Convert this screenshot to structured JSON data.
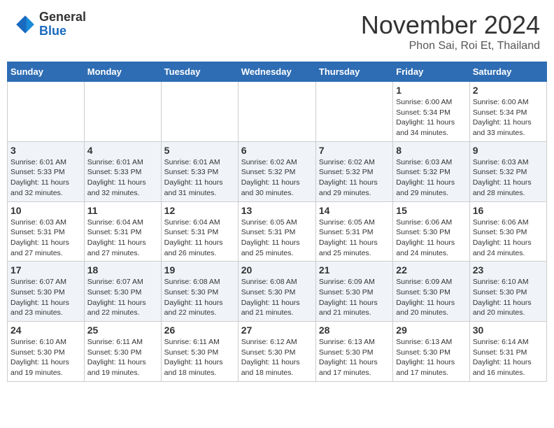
{
  "header": {
    "logo_general": "General",
    "logo_blue": "Blue",
    "month_title": "November 2024",
    "location": "Phon Sai, Roi Et, Thailand"
  },
  "calendar": {
    "days_of_week": [
      "Sunday",
      "Monday",
      "Tuesday",
      "Wednesday",
      "Thursday",
      "Friday",
      "Saturday"
    ],
    "weeks": [
      [
        {
          "day": "",
          "info": ""
        },
        {
          "day": "",
          "info": ""
        },
        {
          "day": "",
          "info": ""
        },
        {
          "day": "",
          "info": ""
        },
        {
          "day": "",
          "info": ""
        },
        {
          "day": "1",
          "info": "Sunrise: 6:00 AM\nSunset: 5:34 PM\nDaylight: 11 hours and 34 minutes."
        },
        {
          "day": "2",
          "info": "Sunrise: 6:00 AM\nSunset: 5:34 PM\nDaylight: 11 hours and 33 minutes."
        }
      ],
      [
        {
          "day": "3",
          "info": "Sunrise: 6:01 AM\nSunset: 5:33 PM\nDaylight: 11 hours and 32 minutes."
        },
        {
          "day": "4",
          "info": "Sunrise: 6:01 AM\nSunset: 5:33 PM\nDaylight: 11 hours and 32 minutes."
        },
        {
          "day": "5",
          "info": "Sunrise: 6:01 AM\nSunset: 5:33 PM\nDaylight: 11 hours and 31 minutes."
        },
        {
          "day": "6",
          "info": "Sunrise: 6:02 AM\nSunset: 5:32 PM\nDaylight: 11 hours and 30 minutes."
        },
        {
          "day": "7",
          "info": "Sunrise: 6:02 AM\nSunset: 5:32 PM\nDaylight: 11 hours and 29 minutes."
        },
        {
          "day": "8",
          "info": "Sunrise: 6:03 AM\nSunset: 5:32 PM\nDaylight: 11 hours and 29 minutes."
        },
        {
          "day": "9",
          "info": "Sunrise: 6:03 AM\nSunset: 5:32 PM\nDaylight: 11 hours and 28 minutes."
        }
      ],
      [
        {
          "day": "10",
          "info": "Sunrise: 6:03 AM\nSunset: 5:31 PM\nDaylight: 11 hours and 27 minutes."
        },
        {
          "day": "11",
          "info": "Sunrise: 6:04 AM\nSunset: 5:31 PM\nDaylight: 11 hours and 27 minutes."
        },
        {
          "day": "12",
          "info": "Sunrise: 6:04 AM\nSunset: 5:31 PM\nDaylight: 11 hours and 26 minutes."
        },
        {
          "day": "13",
          "info": "Sunrise: 6:05 AM\nSunset: 5:31 PM\nDaylight: 11 hours and 25 minutes."
        },
        {
          "day": "14",
          "info": "Sunrise: 6:05 AM\nSunset: 5:31 PM\nDaylight: 11 hours and 25 minutes."
        },
        {
          "day": "15",
          "info": "Sunrise: 6:06 AM\nSunset: 5:30 PM\nDaylight: 11 hours and 24 minutes."
        },
        {
          "day": "16",
          "info": "Sunrise: 6:06 AM\nSunset: 5:30 PM\nDaylight: 11 hours and 24 minutes."
        }
      ],
      [
        {
          "day": "17",
          "info": "Sunrise: 6:07 AM\nSunset: 5:30 PM\nDaylight: 11 hours and 23 minutes."
        },
        {
          "day": "18",
          "info": "Sunrise: 6:07 AM\nSunset: 5:30 PM\nDaylight: 11 hours and 22 minutes."
        },
        {
          "day": "19",
          "info": "Sunrise: 6:08 AM\nSunset: 5:30 PM\nDaylight: 11 hours and 22 minutes."
        },
        {
          "day": "20",
          "info": "Sunrise: 6:08 AM\nSunset: 5:30 PM\nDaylight: 11 hours and 21 minutes."
        },
        {
          "day": "21",
          "info": "Sunrise: 6:09 AM\nSunset: 5:30 PM\nDaylight: 11 hours and 21 minutes."
        },
        {
          "day": "22",
          "info": "Sunrise: 6:09 AM\nSunset: 5:30 PM\nDaylight: 11 hours and 20 minutes."
        },
        {
          "day": "23",
          "info": "Sunrise: 6:10 AM\nSunset: 5:30 PM\nDaylight: 11 hours and 20 minutes."
        }
      ],
      [
        {
          "day": "24",
          "info": "Sunrise: 6:10 AM\nSunset: 5:30 PM\nDaylight: 11 hours and 19 minutes."
        },
        {
          "day": "25",
          "info": "Sunrise: 6:11 AM\nSunset: 5:30 PM\nDaylight: 11 hours and 19 minutes."
        },
        {
          "day": "26",
          "info": "Sunrise: 6:11 AM\nSunset: 5:30 PM\nDaylight: 11 hours and 18 minutes."
        },
        {
          "day": "27",
          "info": "Sunrise: 6:12 AM\nSunset: 5:30 PM\nDaylight: 11 hours and 18 minutes."
        },
        {
          "day": "28",
          "info": "Sunrise: 6:13 AM\nSunset: 5:30 PM\nDaylight: 11 hours and 17 minutes."
        },
        {
          "day": "29",
          "info": "Sunrise: 6:13 AM\nSunset: 5:30 PM\nDaylight: 11 hours and 17 minutes."
        },
        {
          "day": "30",
          "info": "Sunrise: 6:14 AM\nSunset: 5:31 PM\nDaylight: 11 hours and 16 minutes."
        }
      ]
    ]
  }
}
